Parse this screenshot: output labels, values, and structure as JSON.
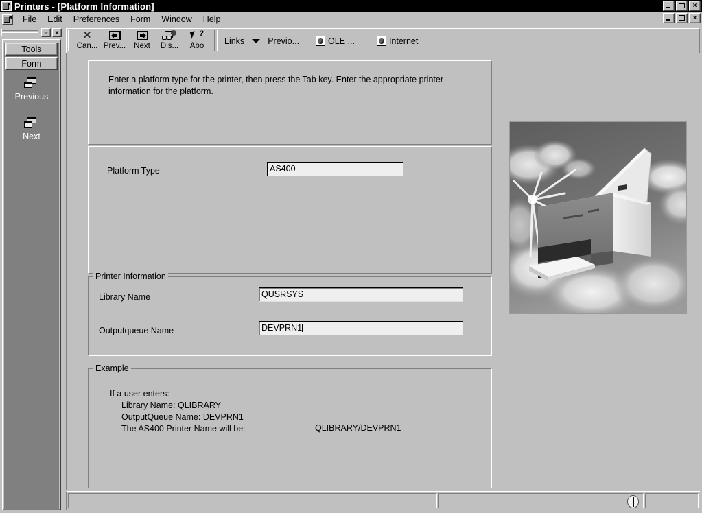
{
  "window": {
    "title": "Printers - [Platform Information]",
    "app_icon": "printers-app-icon",
    "controls": {
      "minimize": "_",
      "maximize": "□",
      "close": "×"
    }
  },
  "menubar": {
    "mdi_icon": "mdi-document-icon",
    "items": [
      {
        "label": "File",
        "accel": "F"
      },
      {
        "label": "Edit",
        "accel": "E"
      },
      {
        "label": "Preferences",
        "accel": "P"
      },
      {
        "label": "Form",
        "accel": "m"
      },
      {
        "label": "Window",
        "accel": "W"
      },
      {
        "label": "Help",
        "accel": "H"
      }
    ]
  },
  "toolbar": {
    "buttons": [
      {
        "label": "Can...",
        "accel": "C",
        "icon": "close-x-icon"
      },
      {
        "label": "Prev...",
        "accel": "P",
        "icon": "arrow-left-box-icon"
      },
      {
        "label": "Next",
        "accel": "x",
        "icon": "arrow-right-box-icon"
      },
      {
        "label": "Dis...",
        "accel": "",
        "icon": "glasses-icon"
      },
      {
        "label": "Abo",
        "accel": "b",
        "icon": "arrow-question-icon"
      }
    ],
    "links_label": "Links",
    "dropdown_icon": "chevron-down-icon",
    "shortcuts": [
      {
        "label": "Previo...",
        "icon": ""
      },
      {
        "label": "OLE ...",
        "icon": "ole-document-icon"
      },
      {
        "label": "Internet",
        "icon": "internet-document-icon"
      }
    ]
  },
  "dock": {
    "dropdown_icon": "chevron-down-icon",
    "close_label": "x",
    "tabs": [
      {
        "label": "Tools"
      },
      {
        "label": "Form"
      }
    ],
    "entries": [
      {
        "label": "Previous",
        "icon": "cascade-windows-icon"
      },
      {
        "label": "Next",
        "icon": "cascade-windows-icon"
      }
    ]
  },
  "form": {
    "instructions": "Enter a platform type for the printer, then press the Tab key.  Enter the appropriate printer information for the platform.",
    "platform": {
      "label": "Platform Type",
      "value": "AS400",
      "placeholder": ""
    },
    "printer_information": {
      "legend": "Printer Information",
      "library": {
        "label": "Library Name",
        "value": "QUSRSYS",
        "placeholder": ""
      },
      "outputqueue": {
        "label": "Outputqueue Name",
        "value": "DEVPRN1",
        "placeholder": ""
      }
    },
    "example": {
      "legend": "Example",
      "line1": "If a user enters:",
      "line2": "Library Name: QLIBRARY",
      "line3": "OutputQueue Name: DEVPRN1",
      "line4": "The AS400 Printer Name will be:",
      "result": "QLIBRARY/DEVPRN1"
    },
    "illustration": "laser-printer-illustration"
  },
  "statusbar": {
    "pane1": "",
    "pane2": "",
    "pane3": "",
    "icon": "globe-icon"
  },
  "colors": {
    "face": "#c0c0c0",
    "dock_body": "#808080",
    "field_bg": "#efefef",
    "titlebar_bg": "#000000",
    "titlebar_fg": "#ffffff",
    "text": "#000000"
  }
}
